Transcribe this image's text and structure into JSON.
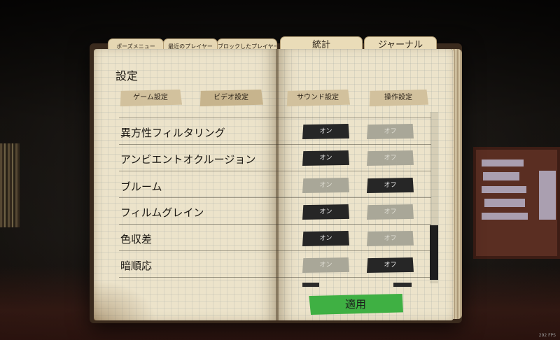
{
  "tabs": [
    {
      "label": "ポーズメニュー",
      "size": "small"
    },
    {
      "label": "最近のプレイヤー",
      "size": "small"
    },
    {
      "label": "ブロックしたプレイヤー",
      "size": "small"
    },
    {
      "label": "統計",
      "size": "big"
    },
    {
      "label": "ジャーナル",
      "size": "big"
    }
  ],
  "page_title": "設定",
  "subtabs": [
    {
      "label": "ゲーム設定"
    },
    {
      "label": "ビデオ設定"
    },
    {
      "label": "サウンド設定"
    },
    {
      "label": "操作設定"
    }
  ],
  "settings": [
    {
      "label": "異方性フィルタリング",
      "on": "オン",
      "off": "オフ",
      "value": "on"
    },
    {
      "label": "アンビエントオクルージョン",
      "on": "オン",
      "off": "オフ",
      "value": "on"
    },
    {
      "label": "ブルーム",
      "on": "オン",
      "off": "オフ",
      "value": "off"
    },
    {
      "label": "フィルムグレイン",
      "on": "オン",
      "off": "オフ",
      "value": "on"
    },
    {
      "label": "色収差",
      "on": "オン",
      "off": "オフ",
      "value": "on"
    },
    {
      "label": "暗順応",
      "on": "オン",
      "off": "オフ",
      "value": "off"
    }
  ],
  "apply_label": "適用",
  "fps": "292 FPS",
  "colors": {
    "toggle_selected": "#262626",
    "toggle_unselected": "#a9a798",
    "apply_button": "#3fb043",
    "paper": "#ece3ca"
  }
}
